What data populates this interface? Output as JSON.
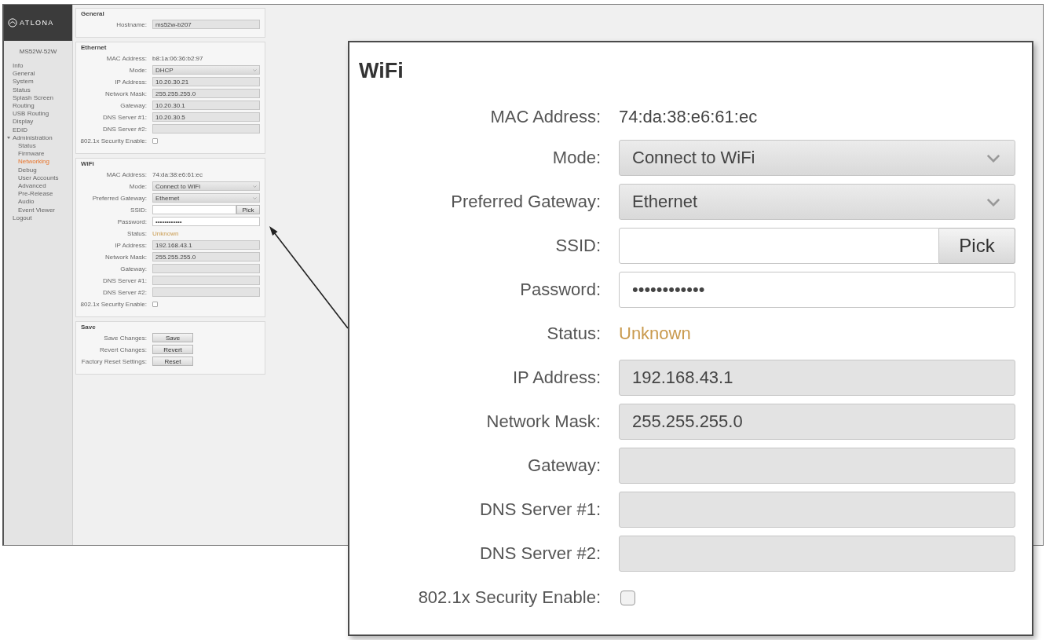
{
  "screenshot": {
    "logo": {
      "text": "ATLONA"
    },
    "sidebar": {
      "device": "MS52W-52W",
      "items": [
        {
          "label": "Info",
          "selected": false
        },
        {
          "label": "General",
          "selected": false
        },
        {
          "label": "System",
          "selected": false
        },
        {
          "label": "Status",
          "selected": false
        },
        {
          "label": "Splash Screen",
          "selected": false
        },
        {
          "label": "Routing",
          "selected": false
        },
        {
          "label": "USB Routing",
          "selected": false
        },
        {
          "label": "Display",
          "selected": false
        },
        {
          "label": "EDID",
          "selected": false
        },
        {
          "label": "Administration",
          "selected": false,
          "children": [
            {
              "label": "Status",
              "selected": false
            },
            {
              "label": "Firmware",
              "selected": false
            },
            {
              "label": "Networking",
              "selected": true
            },
            {
              "label": "Debug",
              "selected": false
            },
            {
              "label": "User Accounts",
              "selected": false
            },
            {
              "label": "Advanced",
              "selected": false
            },
            {
              "label": "Pre-Release",
              "selected": false
            },
            {
              "label": "Audio",
              "selected": false
            },
            {
              "label": "Event Viewer",
              "selected": false
            }
          ]
        },
        {
          "label": "Logout",
          "selected": false
        }
      ]
    },
    "sections": [
      {
        "title": "General",
        "rows": [
          {
            "kind": "input",
            "label": "Hostname:",
            "value": "ms52w-b207",
            "disabled": true
          }
        ]
      },
      {
        "title": "Ethernet",
        "rows": [
          {
            "kind": "text",
            "label": "MAC Address:",
            "value": "b8:1a:06:36:b2:97"
          },
          {
            "kind": "select",
            "label": "Mode:",
            "value": "DHCP"
          },
          {
            "kind": "input",
            "label": "IP Address:",
            "value": "10.20.30.21",
            "disabled": true
          },
          {
            "kind": "input",
            "label": "Network Mask:",
            "value": "255.255.255.0",
            "disabled": true
          },
          {
            "kind": "input",
            "label": "Gateway:",
            "value": "10.20.30.1",
            "disabled": true
          },
          {
            "kind": "input",
            "label": "DNS Server #1:",
            "value": "10.20.30.5",
            "disabled": true
          },
          {
            "kind": "input",
            "label": "DNS Server #2:",
            "disabled": true
          },
          {
            "kind": "checkbox",
            "label": "802.1x Security Enable:",
            "checked": false
          }
        ]
      },
      {
        "title": "WiFi",
        "rows": [
          {
            "kind": "text",
            "label": "MAC Address:",
            "value": "74:da:38:e6:61:ec"
          },
          {
            "kind": "select",
            "label": "Mode:",
            "value": "Connect to WiFi"
          },
          {
            "kind": "select",
            "label": "Preferred Gateway:",
            "value": "Ethernet"
          },
          {
            "kind": "input_pick",
            "label": "SSID:",
            "button": "Pick",
            "disabled": false
          },
          {
            "kind": "input",
            "label": "Password:",
            "value": "••••••••••••",
            "disabled": false
          },
          {
            "kind": "status",
            "label": "Status:",
            "value": "Unknown"
          },
          {
            "kind": "input",
            "label": "IP Address:",
            "value": "192.168.43.1",
            "disabled": true
          },
          {
            "kind": "input",
            "label": "Network Mask:",
            "value": "255.255.255.0",
            "disabled": true
          },
          {
            "kind": "input",
            "label": "Gateway:",
            "disabled": true
          },
          {
            "kind": "input",
            "label": "DNS Server #1:",
            "disabled": true
          },
          {
            "kind": "input",
            "label": "DNS Server #2:",
            "disabled": true
          },
          {
            "kind": "checkbox",
            "label": "802.1x Security Enable:",
            "checked": false
          }
        ]
      },
      {
        "title": "Save",
        "rows": [
          {
            "kind": "button",
            "label": "Save Changes:",
            "button": "Save"
          },
          {
            "kind": "button",
            "label": "Revert Changes:",
            "button": "Revert"
          },
          {
            "kind": "button",
            "label": "Factory Reset Settings:",
            "button": "Reset"
          }
        ]
      }
    ]
  },
  "callout": {
    "title": "WiFi",
    "rows": [
      {
        "kind": "text",
        "label": "MAC Address:",
        "value": "74:da:38:e6:61:ec"
      },
      {
        "kind": "select",
        "label": "Mode:",
        "value": "Connect to WiFi"
      },
      {
        "kind": "select",
        "label": "Preferred Gateway:",
        "value": "Ethernet"
      },
      {
        "kind": "input_pick",
        "label": "SSID:",
        "button": "Pick",
        "disabled": false
      },
      {
        "kind": "input",
        "label": "Password:",
        "value": "••••••••••••",
        "disabled": false
      },
      {
        "kind": "status",
        "label": "Status:",
        "value": "Unknown"
      },
      {
        "kind": "input",
        "label": "IP Address:",
        "value": "192.168.43.1",
        "disabled": true
      },
      {
        "kind": "input",
        "label": "Network Mask:",
        "value": "255.255.255.0",
        "disabled": true
      },
      {
        "kind": "input",
        "label": "Gateway:",
        "disabled": true
      },
      {
        "kind": "input",
        "label": "DNS Server #1:",
        "disabled": true
      },
      {
        "kind": "input",
        "label": "DNS Server #2:",
        "disabled": true
      },
      {
        "kind": "checkbox",
        "label": "802.1x Security Enable:",
        "checked": false
      }
    ]
  }
}
